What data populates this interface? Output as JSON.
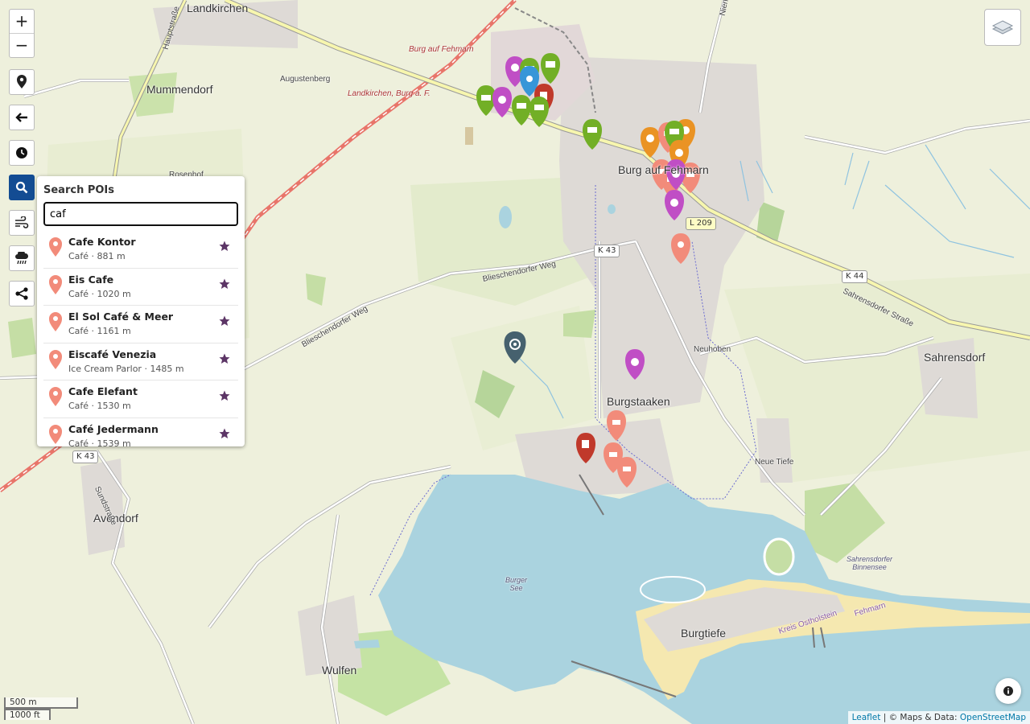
{
  "controls": {
    "zoom_in": "+",
    "zoom_out": "−"
  },
  "search_panel": {
    "title": "Search POIs",
    "query": "caf",
    "results": [
      {
        "name": "Cafe Kontor",
        "meta": "Café · 881 m"
      },
      {
        "name": "Eis Cafe",
        "meta": "Café · 1020 m"
      },
      {
        "name": "El Sol Café & Meer",
        "meta": "Café · 1161 m"
      },
      {
        "name": "Eiscafé Venezia",
        "meta": "Ice Cream Parlor · 1485 m"
      },
      {
        "name": "Cafe Elefant",
        "meta": "Café · 1530 m"
      },
      {
        "name": "Café Jedermann",
        "meta": "Café · 1539 m"
      }
    ]
  },
  "map_labels": {
    "landkirchen": "Landkirchen",
    "mummendorf": "Mummendorf",
    "augustenberg": "Augustenberg",
    "burg_auf_fehmarn_station": "Burg auf Fehmarn",
    "landkirchen_burg": "Landkirchen, Burg a. F.",
    "burg_town": "Burg auf Fehmarn",
    "rosenhof": "Rosenhof",
    "neuhoben": "Neuhoben",
    "burgstaaken": "Burgstaaken",
    "sahrensdorf": "Sahrensdorf",
    "neue_tiefe": "Neue Tiefe",
    "avendorf": "Avendorf",
    "wulfen": "Wulfen",
    "burgtiefe": "Burgtiefe",
    "burger_see": "Burger\nSee",
    "sahrensdorfer_binnensee": "Sahrensdorfer\nBinnensee",
    "bliesch_weg_1": "Blieschendorfer Weg",
    "bliesch_weg_2": "Blieschendorfer Weg",
    "sahrensdorfer_strasse": "Sahrensdorfer Straße",
    "hauptstrasse": "Hauptstraße",
    "sundstrasse": "Sundstraße",
    "kreis": "Kreis Ostholstein",
    "fehmarn": "Fehmarn",
    "niendorf_road": "Nien"
  },
  "road_signs": {
    "l209": "L 209",
    "k43a": "K 43",
    "k43b": "K 43",
    "k44": "K 44"
  },
  "scale": {
    "metric": "500 m",
    "imperial": "1000 ft"
  },
  "attribution": {
    "leaflet": "Leaflet",
    "separator": "|",
    "text": "© Maps & Data:",
    "osm": "OpenStreetMap"
  },
  "colors": {
    "land": "#eef0dc",
    "water": "#aad3df",
    "urban": "#dcd8d8",
    "farmland": "#e6ecd0",
    "forest": "#c5dea5",
    "active_control": "#134c93",
    "cafe_pin": "#f28b7a",
    "shop_pin": "#72af26",
    "food_pin": "#c04ec5",
    "fuel_pin": "#c0392b",
    "bakery_pin": "#ea9324",
    "star": "#5c3566"
  },
  "icons": {
    "zoom_in": "plus-icon",
    "zoom_out": "minus-icon",
    "locate": "map-pin-icon",
    "back": "arrow-left-icon",
    "history": "clock-icon",
    "search": "search-icon",
    "wind": "wind-icon",
    "rain": "rain-cloud-icon",
    "share": "share-icon",
    "layers": "layers-icon",
    "info": "info-icon"
  }
}
